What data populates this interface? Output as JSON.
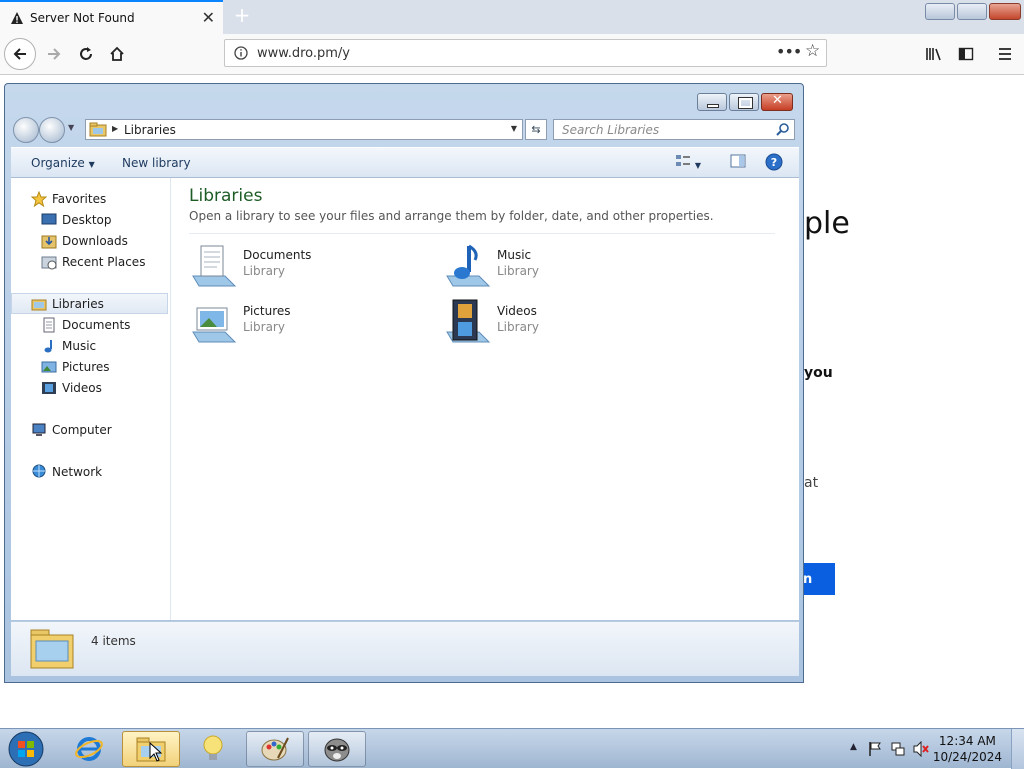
{
  "browser": {
    "tab_title": "Server Not Found",
    "url": "www.dro.pm/y"
  },
  "background_page": {
    "fragment_1": "ple",
    "fragment_2": "you",
    "fragment_3": "at",
    "button_fragment": "n"
  },
  "explorer": {
    "breadcrumb": "Libraries",
    "search_placeholder": "Search Libraries",
    "toolbar": {
      "organize": "Organize",
      "new_library": "New library"
    },
    "nav": {
      "favorites": "Favorites",
      "desktop": "Desktop",
      "downloads": "Downloads",
      "recent_places": "Recent Places",
      "libraries": "Libraries",
      "documents": "Documents",
      "music": "Music",
      "pictures": "Pictures",
      "videos": "Videos",
      "computer": "Computer",
      "network": "Network"
    },
    "content": {
      "title": "Libraries",
      "subtitle": "Open a library to see your files and arrange them by folder, date, and other properties.",
      "items": [
        {
          "name": "Documents",
          "kind": "Library"
        },
        {
          "name": "Music",
          "kind": "Library"
        },
        {
          "name": "Pictures",
          "kind": "Library"
        },
        {
          "name": "Videos",
          "kind": "Library"
        }
      ]
    },
    "status": "4 items"
  },
  "taskbar": {
    "time": "12:34 AM",
    "date": "10/24/2024"
  }
}
